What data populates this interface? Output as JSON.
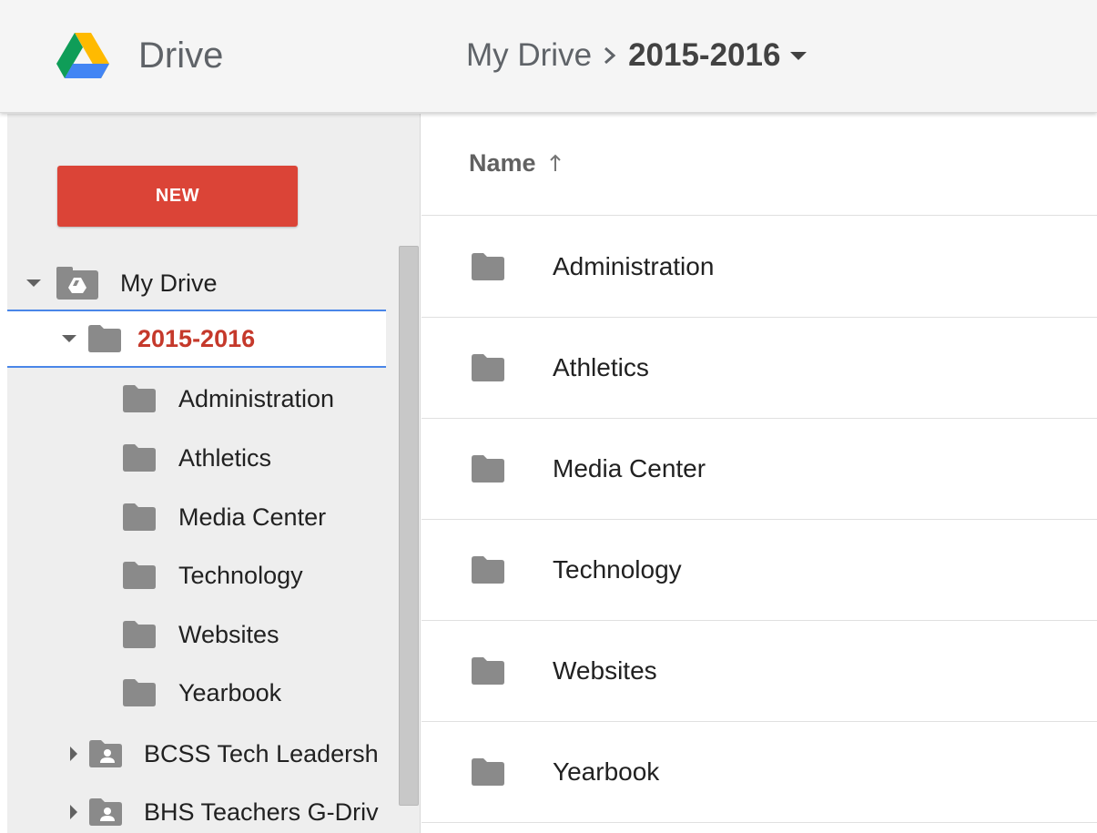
{
  "header": {
    "app_name": "Drive",
    "breadcrumb": {
      "root": "My Drive",
      "current": "2015-2016"
    }
  },
  "sidebar": {
    "new_button": "NEW",
    "tree": {
      "my_drive": "My Drive",
      "selected_folder": "2015-2016",
      "children": [
        "Administration",
        "Athletics",
        "Media Center",
        "Technology",
        "Websites",
        "Yearbook"
      ],
      "shared": [
        "BCSS Tech Leadersh",
        "BHS Teachers G-Driv"
      ]
    }
  },
  "list": {
    "column_header": "Name",
    "sort_icon": "arrow-up-icon",
    "rows": [
      "Administration",
      "Athletics",
      "Media Center",
      "Technology",
      "Websites",
      "Yearbook"
    ]
  },
  "colors": {
    "new_button": "#db4437",
    "selected_text": "#c5392b",
    "selection_border": "#4a86e8",
    "folder_icon": "#8a8a8a"
  }
}
